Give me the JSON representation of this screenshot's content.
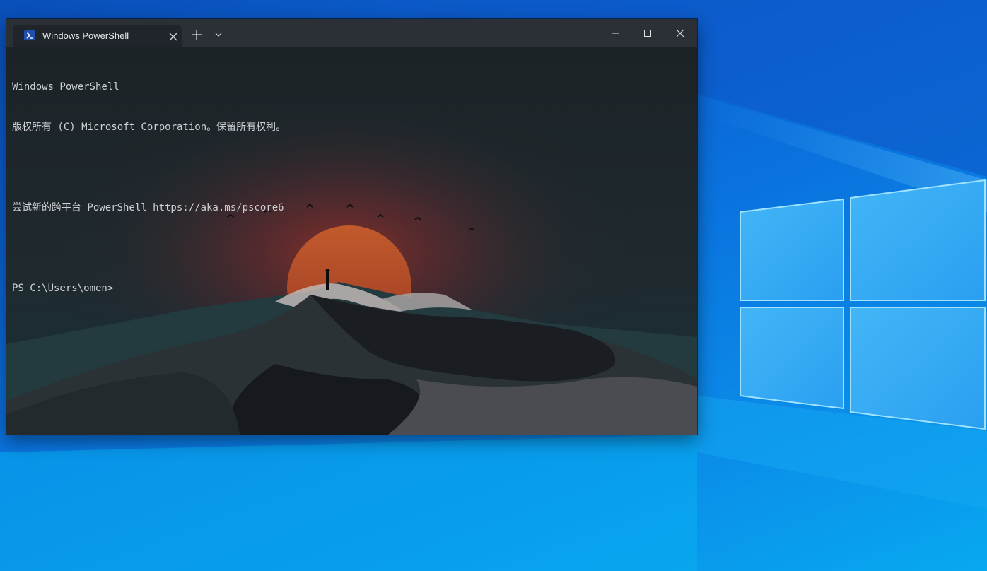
{
  "desktop": {
    "accent_color": "#0a78e0",
    "logo": "windows-logo"
  },
  "terminal": {
    "tab": {
      "icon": "powershell-icon",
      "title": "Windows PowerShell",
      "close_icon": "close-icon"
    },
    "new_tab_icon": "plus-icon",
    "dropdown_icon": "chevron-down-icon",
    "window_controls": {
      "minimize_icon": "minimize-icon",
      "maximize_icon": "maximize-icon",
      "close_icon": "close-icon"
    },
    "background_image": "desert-dunes-sunset",
    "lines": [
      "Windows PowerShell",
      "版权所有 (C) Microsoft Corporation。保留所有权利。",
      "",
      "尝试新的跨平台 PowerShell https://aka.ms/pscore6",
      "",
      "PS C:\\Users\\omen>"
    ]
  }
}
